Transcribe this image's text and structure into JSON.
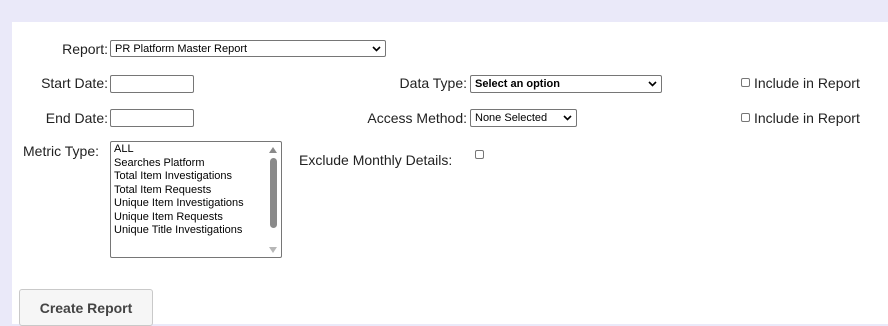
{
  "form": {
    "report": {
      "label": "Report:",
      "value": "PR Platform Master Report"
    },
    "start_date": {
      "label": "Start Date:",
      "value": ""
    },
    "end_date": {
      "label": "End Date:",
      "value": ""
    },
    "data_type": {
      "label": "Data Type:",
      "value": "Select an option"
    },
    "access_method": {
      "label": "Access Method:",
      "value": "None Selected"
    },
    "include_label": "Include in Report",
    "metric_type": {
      "label": "Metric Type:",
      "options": [
        "ALL",
        "Searches Platform",
        "Total Item Investigations",
        "Total Item Requests",
        "Unique Item Investigations",
        "Unique Item Requests",
        "Unique Title Investigations"
      ]
    },
    "exclude_monthly": {
      "label": "Exclude Monthly Details:",
      "checked": false
    },
    "submit_label": "Create Report"
  },
  "icons": {
    "dropdown": "chevron-down-icon",
    "scroll_up": "scroll-up-icon",
    "scroll_down": "scroll-down-icon"
  },
  "colors": {
    "page_background": "#eae9f9",
    "panel_background": "#ffffff",
    "button_background": "#f6f6f6"
  }
}
